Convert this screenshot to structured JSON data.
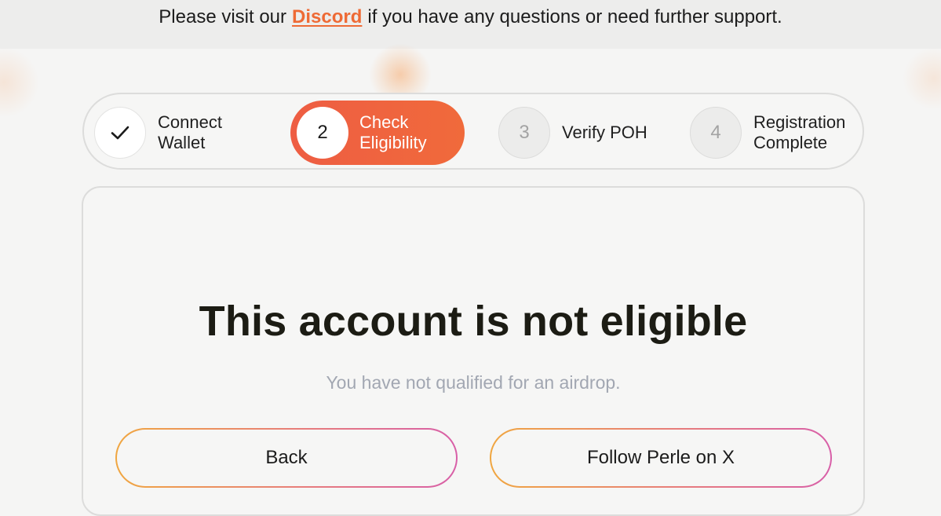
{
  "banner": {
    "prefix": "Please visit our",
    "link_label": "Discord",
    "suffix": "if you have any questions or need further support."
  },
  "stepper": {
    "steps": [
      {
        "marker": "✓",
        "icon": "checkmark-icon",
        "label_line1": "Connect",
        "label_line2": "Wallet",
        "state": "completed"
      },
      {
        "marker": "2",
        "label_line1": "Check",
        "label_line2": "Eligibility",
        "state": "active"
      },
      {
        "marker": "3",
        "label_line1": "Verify POH",
        "label_line2": "",
        "state": "pending"
      },
      {
        "marker": "4",
        "label_line1": "Registration",
        "label_line2": "Complete",
        "state": "pending"
      }
    ]
  },
  "result": {
    "title": "This account is not eligible",
    "message": "You have not qualified for an airdrop."
  },
  "actions": {
    "back_label": "Back",
    "follow_label": "Follow Perle on X"
  },
  "colors": {
    "accent": "#ee6a35",
    "active_step": "#ee5d43",
    "button_gradient_start": "#f0a640",
    "button_gradient_end": "#d85fa8",
    "subtext": "#a2a7b2"
  }
}
